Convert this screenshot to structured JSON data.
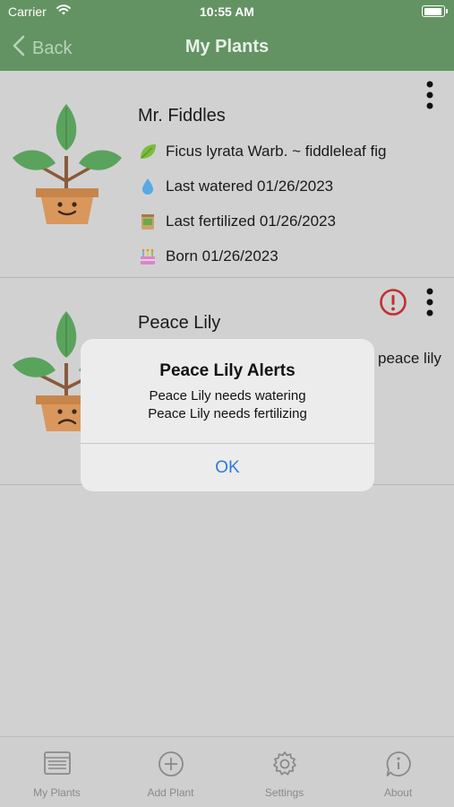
{
  "status_bar": {
    "carrier": "Carrier",
    "time": "10:55 AM"
  },
  "nav": {
    "back_label": "Back",
    "title": "My Plants"
  },
  "plants": [
    {
      "name": "Mr. Fiddles",
      "species": "Ficus lyrata Warb. ~ fiddleleaf fig",
      "last_watered": "Last watered 01/26/2023",
      "last_fertilized": "Last fertilized 01/26/2023",
      "born": "Born 01/26/2023",
      "mood": "happy"
    },
    {
      "name": "Peace Lily",
      "species_visible_fragment": "peace lily",
      "mood": "sad",
      "has_alert": true
    }
  ],
  "alert": {
    "title": "Peace Lily Alerts",
    "messages": [
      "Peace Lily needs watering",
      "Peace Lily needs fertilizing"
    ],
    "ok_label": "OK"
  },
  "tabs": [
    {
      "label": "My Plants",
      "icon": "list-icon",
      "selected": true
    },
    {
      "label": "Add Plant",
      "icon": "plus-circle-icon",
      "selected": false
    },
    {
      "label": "Settings",
      "icon": "gear-icon",
      "selected": false
    },
    {
      "label": "About",
      "icon": "info-icon",
      "selected": false
    }
  ],
  "colors": {
    "header_green": "#639363",
    "alert_red": "#c0302f",
    "link_blue": "#2f7ad9"
  }
}
